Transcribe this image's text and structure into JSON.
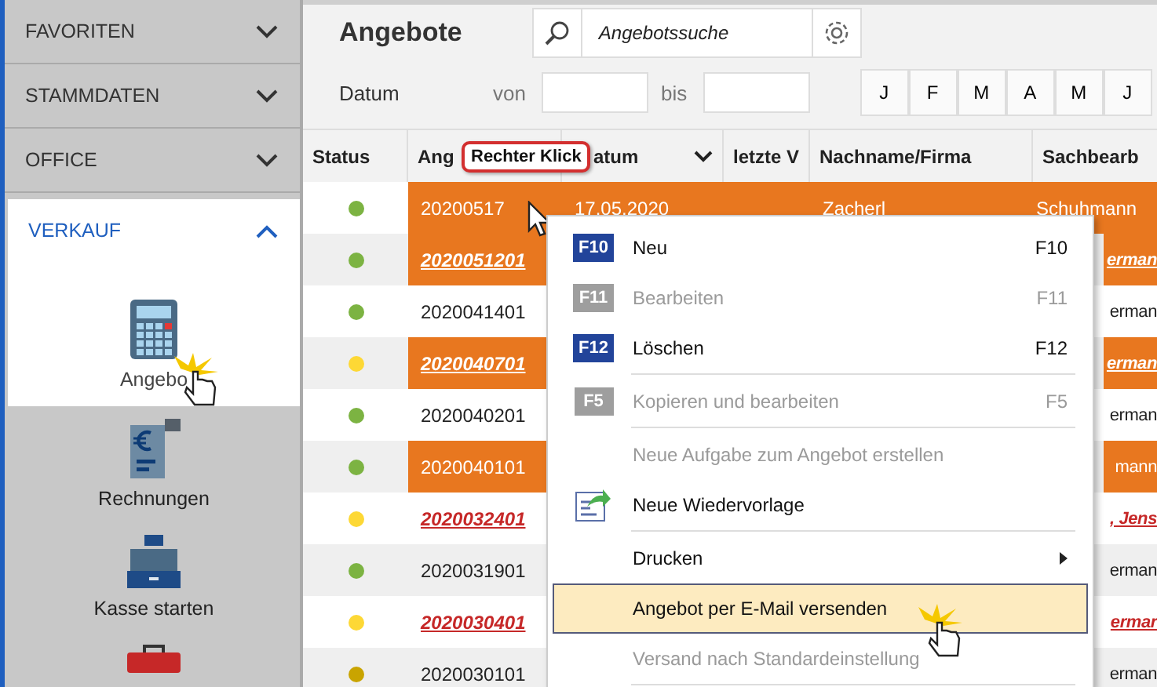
{
  "sidebar": {
    "sections": [
      {
        "label": "FAVORITEN",
        "expanded": false
      },
      {
        "label": "STAMMDATEN",
        "expanded": false
      },
      {
        "label": "OFFICE",
        "expanded": false
      },
      {
        "label": "VERKAUF",
        "expanded": true,
        "items": [
          {
            "label": "Angebo",
            "kind": "calculator",
            "selected": true
          },
          {
            "label": "Rechnungen",
            "kind": "invoice",
            "selected": false
          },
          {
            "label": "Kasse starten",
            "kind": "register",
            "selected": false
          },
          {
            "kind": "briefcase",
            "selected": false
          }
        ]
      }
    ]
  },
  "header": {
    "title": "Angebote",
    "search": {
      "placeholder": "Angebotssuche"
    }
  },
  "filter": {
    "label": "Datum",
    "from_label": "von",
    "to_label": "bis",
    "months": [
      "J",
      "F",
      "M",
      "A",
      "M",
      "J"
    ]
  },
  "table": {
    "columns": [
      "Status",
      "Ang",
      "atum",
      "letzte V",
      "Nachname/Firma",
      "Sachbearb"
    ],
    "rows": [
      {
        "color": "#7cb342",
        "number": "20200517",
        "date": "17.05.2020",
        "name": "Zacherl",
        "clerk": "Schuhmann",
        "selected": true,
        "flagged": true,
        "kind": "plain"
      },
      {
        "color": "#7cb342",
        "number": "2020051201",
        "clerk": "erman",
        "selected": false,
        "flagged": true,
        "kind": "link"
      },
      {
        "color": "#7cb342",
        "number": "2020041401",
        "clerk": "erman",
        "selected": false,
        "flagged": false,
        "kind": "plain"
      },
      {
        "color": "#fdd835",
        "number": "2020040701",
        "clerk": "erman",
        "selected": false,
        "flagged": true,
        "kind": "link"
      },
      {
        "color": "#7cb342",
        "number": "2020040201",
        "clerk": "erman",
        "selected": false,
        "flagged": false,
        "kind": "plain"
      },
      {
        "color": "#7cb342",
        "number": "2020040101",
        "clerk": "mann",
        "selected": false,
        "flagged": true,
        "kind": "plain"
      },
      {
        "color": "#fdd835",
        "number": "2020032401",
        "clerk": ", Jens",
        "selected": false,
        "flagged": false,
        "kind": "overdue"
      },
      {
        "color": "#7cb342",
        "number": "2020031901",
        "clerk": "erman",
        "selected": false,
        "flagged": false,
        "kind": "plain"
      },
      {
        "color": "#fdd835",
        "number": "2020030401",
        "clerk": "ermar",
        "selected": false,
        "flagged": false,
        "kind": "overdue"
      },
      {
        "color": "#c9a400",
        "number": "2020030101",
        "clerk": "erman",
        "selected": false,
        "flagged": false,
        "kind": "plain"
      }
    ]
  },
  "context_menu": {
    "items": [
      {
        "kind": "command",
        "key": "F10",
        "label": "Neu",
        "shortcut": "F10",
        "disabled": false,
        "selected": false
      },
      {
        "kind": "command",
        "key": "F11",
        "label": "Bearbeiten",
        "shortcut": "F11",
        "disabled": true,
        "selected": false
      },
      {
        "kind": "command",
        "key": "F12",
        "label": "Löschen",
        "shortcut": "F12",
        "disabled": false,
        "selected": false
      },
      {
        "kind": "separator"
      },
      {
        "kind": "command",
        "key": "F5",
        "label": "Kopieren und bearbeiten",
        "shortcut": "F5",
        "disabled": true,
        "selected": false
      },
      {
        "kind": "separator"
      },
      {
        "kind": "command",
        "label": "Neue Aufgabe zum Angebot erstellen",
        "disabled": true,
        "selected": false
      },
      {
        "kind": "icon-command",
        "label": "Neue Wiedervorlage",
        "disabled": false,
        "selected": false
      },
      {
        "kind": "separator"
      },
      {
        "kind": "submenu",
        "label": "Drucken",
        "disabled": false,
        "selected": false
      },
      {
        "kind": "command",
        "label": "Angebot per E-Mail versenden",
        "disabled": false,
        "selected": true
      },
      {
        "kind": "command",
        "label": "Versand nach Standardeinstellung",
        "disabled": true,
        "selected": false
      },
      {
        "kind": "separator"
      }
    ]
  },
  "callout": {
    "text": "Rechter Klick"
  }
}
